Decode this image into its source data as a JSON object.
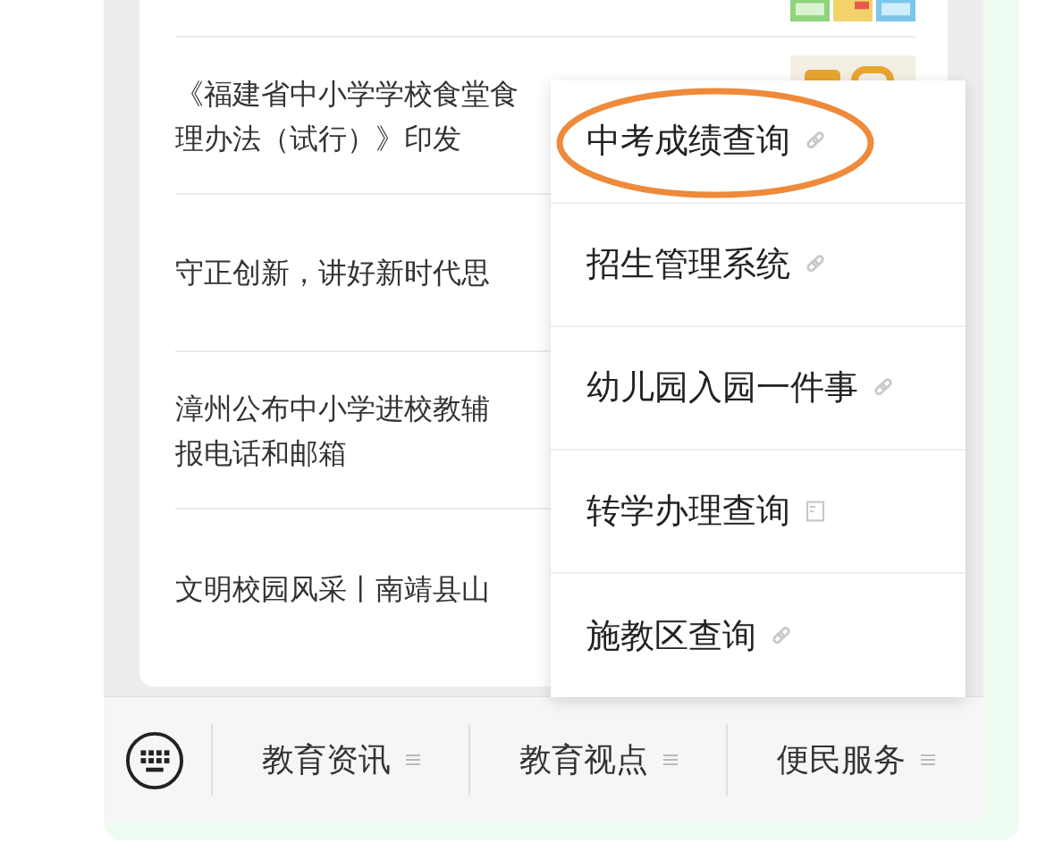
{
  "news": [
    {
      "thumbnail": {
        "kind": "picture"
      }
    },
    {
      "lines": [
        "《福建省中小学学校食堂食",
        "理办法（试行）》印发"
      ],
      "thumbnail": {
        "kind": "picture"
      }
    },
    {
      "lines": [
        "守正创新，讲好新时代思"
      ]
    },
    {
      "lines": [
        "漳州公布中小学进校教辅",
        "报电话和邮箱"
      ]
    },
    {
      "lines": [
        "文明校园风采丨南靖县山"
      ]
    }
  ],
  "menu": [
    {
      "label": "中考成绩查询",
      "kind": "link",
      "highlighted": true
    },
    {
      "label": "招生管理系统",
      "kind": "link",
      "highlighted": false
    },
    {
      "label": "幼儿园入园一件事",
      "kind": "link",
      "highlighted": false
    },
    {
      "label": "转学办理查询",
      "kind": "page",
      "highlighted": false
    },
    {
      "label": "施教区查询",
      "kind": "link",
      "highlighted": false
    }
  ],
  "bottom_tabs": [
    "教育资讯",
    "教育视点",
    "便民服务"
  ]
}
